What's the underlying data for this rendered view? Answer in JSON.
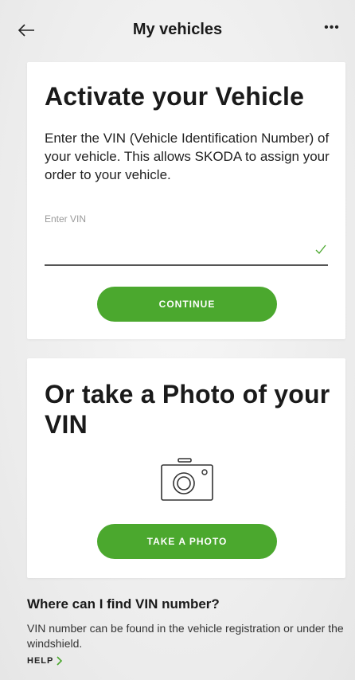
{
  "header": {
    "title": "My vehicles",
    "back_icon": "arrow-left-icon",
    "more_icon": "more-dots-icon",
    "more_glyph": "•••"
  },
  "activate_card": {
    "title": "Activate your Vehicle",
    "description": "Enter the VIN (Vehicle Identification Number) of your vehicle. This allows SKODA to assign your order to your vehicle.",
    "vin_label": "Enter VIN",
    "vin_value": "",
    "valid_icon": "checkmark-icon",
    "continue_label": "CONTINUE"
  },
  "photo_card": {
    "title": "Or take a Photo of your VIN",
    "camera_icon": "camera-icon",
    "take_photo_label": "TAKE A PHOTO"
  },
  "help": {
    "title": "Where can I find VIN number?",
    "description": "VIN number can be found in the vehicle registration or under the windshield.",
    "link_label": "HELP",
    "link_icon": "chevron-right-icon"
  },
  "colors": {
    "accent_green": "#4ba82e",
    "background": "#ececec",
    "card": "#ffffff"
  }
}
